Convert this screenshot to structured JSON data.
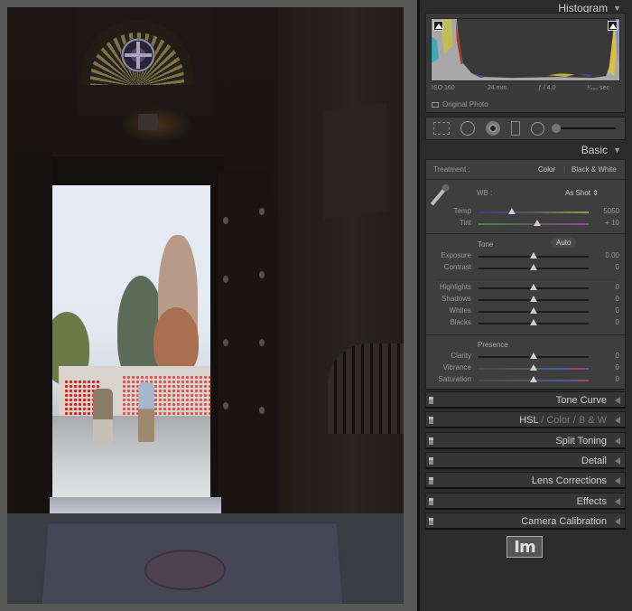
{
  "photo": {
    "description": "Dark church interior doorway looking out to a bright courtyard with two people walking; clipped highlights shown in red",
    "highlight_clipping_color": "#ee1010",
    "shadow_clipping_color": "#2a2aee"
  },
  "panel": {
    "histogram": {
      "title": "Histogram",
      "exif": {
        "iso": "ISO 160",
        "focal_length": "24 mm",
        "aperture": "ƒ / 4.0",
        "shutter": "¹⁄₄₀₀ sec"
      },
      "original_photo_label": "Original Photo"
    },
    "tools": [
      "grid-overlay",
      "spot-removal",
      "red-eye",
      "graduated-filter",
      "radial-filter",
      "adjustment-brush"
    ],
    "basic": {
      "title": "Basic",
      "treatment_label": "Treatment :",
      "treatment_options": [
        "Color",
        "Black & White"
      ],
      "treatment_selected": "Color",
      "separator": "|",
      "wb_label": "WB :",
      "wb_value": "As Shot ⇕",
      "temp": {
        "label": "Temp",
        "value": "5050",
        "position": 0.3
      },
      "tint": {
        "label": "Tint",
        "value": "+ 10",
        "position": 0.53
      },
      "tone_label": "Tone",
      "auto_label": "Auto",
      "tone_sliders": [
        {
          "label": "Exposure",
          "value": "0.00",
          "position": 0.5
        },
        {
          "label": "Contrast",
          "value": "0",
          "position": 0.5
        }
      ],
      "region_sliders": [
        {
          "label": "Highlights",
          "value": "0",
          "position": 0.5
        },
        {
          "label": "Shadows",
          "value": "0",
          "position": 0.5
        },
        {
          "label": "Whites",
          "value": "0",
          "position": 0.5
        },
        {
          "label": "Blacks",
          "value": "0",
          "position": 0.5
        }
      ],
      "presence_label": "Presence",
      "presence_sliders": [
        {
          "label": "Clarity",
          "value": "0",
          "position": 0.5
        },
        {
          "label": "Vibrance",
          "value": "0",
          "position": 0.5
        },
        {
          "label": "Saturation",
          "value": "0",
          "position": 0.5
        }
      ]
    },
    "collapsed_sections": [
      {
        "title": "Tone Curve"
      },
      {
        "title_parts": [
          "HSL",
          " / ",
          "Color",
          " / ",
          "B & W"
        ]
      },
      {
        "title": "Split Toning"
      },
      {
        "title": "Detail"
      },
      {
        "title": "Lens Corrections"
      },
      {
        "title": "Effects"
      },
      {
        "title": "Camera Calibration"
      }
    ],
    "logo_text": "Im"
  }
}
